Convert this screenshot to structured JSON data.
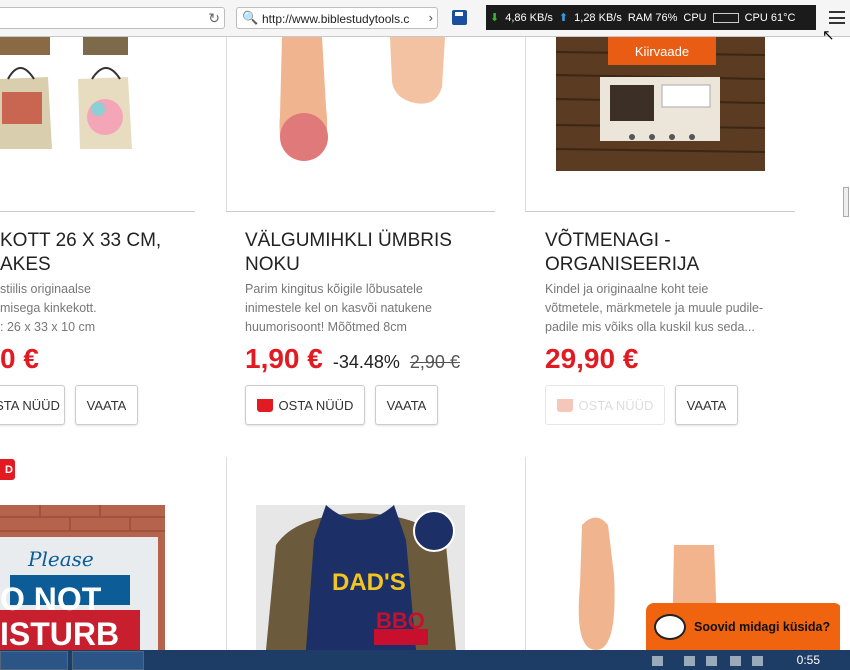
{
  "browser": {
    "address_url": "http://www.biblestudytools.c",
    "stats": {
      "down": "4,86 KB/s",
      "up": "1,28 KB/s",
      "ram": "RAM 76%",
      "cpu_label": "CPU",
      "cpu_temp": "CPU 61°C"
    }
  },
  "quick_view_label": "Kiirvaade",
  "products": [
    {
      "title_line1": "KOTT 26 X 33 CM,",
      "title_line2": "AKES",
      "desc": [
        "stiilis originaalse",
        "misega kinkekott.",
        ": 26 x 33 x 10 cm"
      ],
      "price": "0 €",
      "buy_label": "STA NÜÜD",
      "view_label": "VAATA"
    },
    {
      "title_line1": "VÄLGUMIHKLI ÜMBRIS",
      "title_line2": "NOKU",
      "desc": [
        "Parim kingitus kõigile lõbusatele",
        "inimestele kel on kasvõi natukene",
        "huumorisoont! Mõõtmed 8cm"
      ],
      "price": "1,90 €",
      "discount": "-34.48%",
      "old_price": "2,90 €",
      "buy_label": "OSTA NÜÜD",
      "view_label": "VAATA"
    },
    {
      "title_line1": "VÕTMENAGI -",
      "title_line2": "ORGANISEERIJA",
      "desc": [
        "Kindel ja originaalne koht teie",
        "võtmetele, märkmetele ja muule pudile-",
        "padile mis võiks olla kuskil kus seda..."
      ],
      "price": "29,90 €",
      "buy_label": "OSTA NÜÜD",
      "view_label": "VAATA"
    }
  ],
  "row2": {
    "badge": "D",
    "apron_text1": "DAD'S",
    "apron_text2": "BBQ",
    "sign_text1": "Please",
    "sign_text2": "O NOT",
    "sign_text3": "ISTURB"
  },
  "chat": {
    "label": "Soovid midagi küsida?"
  },
  "taskbar": {
    "clock": "0:55"
  },
  "colors": {
    "accent": "#e21b22",
    "orange": "#e85c13",
    "chat": "#f0630f"
  }
}
